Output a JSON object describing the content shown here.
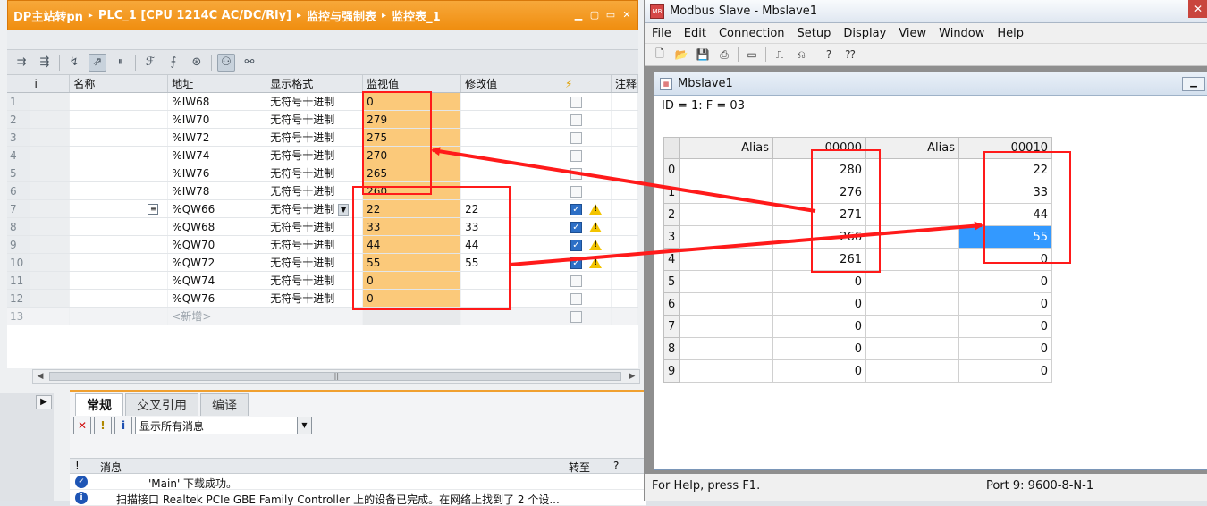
{
  "tia": {
    "breadcrumb": [
      "DP主站转pn",
      "PLC_1 [CPU 1214C AC/DC/Rly]",
      "监控与强制表",
      "监控表_1"
    ],
    "columns": {
      "info": "i",
      "name": "名称",
      "address": "地址",
      "format": "显示格式",
      "monitor": "监视值",
      "modify": "修改值",
      "comment": "注释"
    },
    "rows": [
      {
        "n": "1",
        "addr": "%IW68",
        "fmt": "无符号十进制",
        "mon": "0",
        "mod": "",
        "checked": false,
        "warn": false
      },
      {
        "n": "2",
        "addr": "%IW70",
        "fmt": "无符号十进制",
        "mon": "279",
        "mod": "",
        "checked": false,
        "warn": false
      },
      {
        "n": "3",
        "addr": "%IW72",
        "fmt": "无符号十进制",
        "mon": "275",
        "mod": "",
        "checked": false,
        "warn": false
      },
      {
        "n": "4",
        "addr": "%IW74",
        "fmt": "无符号十进制",
        "mon": "270",
        "mod": "",
        "checked": false,
        "warn": false
      },
      {
        "n": "5",
        "addr": "%IW76",
        "fmt": "无符号十进制",
        "mon": "265",
        "mod": "",
        "checked": false,
        "warn": false
      },
      {
        "n": "6",
        "addr": "%IW78",
        "fmt": "无符号十进制",
        "mon": "260",
        "mod": "",
        "checked": false,
        "warn": false
      },
      {
        "n": "7",
        "addr": "%QW66",
        "fmt": "无符号十进制",
        "mon": "22",
        "mod": "22",
        "checked": true,
        "warn": true
      },
      {
        "n": "8",
        "addr": "%QW68",
        "fmt": "无符号十进制",
        "mon": "33",
        "mod": "33",
        "checked": true,
        "warn": true
      },
      {
        "n": "9",
        "addr": "%QW70",
        "fmt": "无符号十进制",
        "mon": "44",
        "mod": "44",
        "checked": true,
        "warn": true
      },
      {
        "n": "10",
        "addr": "%QW72",
        "fmt": "无符号十进制",
        "mon": "55",
        "mod": "55",
        "checked": true,
        "warn": true
      },
      {
        "n": "11",
        "addr": "%QW74",
        "fmt": "无符号十进制",
        "mon": "0",
        "mod": "",
        "checked": false,
        "warn": false
      },
      {
        "n": "12",
        "addr": "%QW76",
        "fmt": "无符号十进制",
        "mon": "0",
        "mod": "",
        "checked": false,
        "warn": false
      }
    ],
    "new_row": {
      "n": "13",
      "addr": "<新增>"
    },
    "bottom_tabs": [
      "常规",
      "交叉引用",
      "编译"
    ],
    "filter": {
      "selected": "显示所有消息"
    },
    "msg_columns": {
      "flag": "!",
      "message": "消息",
      "goto": "转至",
      "help": "?"
    },
    "messages": [
      "'Main' 下载成功。",
      "扫描接口 Realtek PCIe GBE Family Controller 上的设备已完成。在网络上找到了 2 个设..."
    ],
    "icons": {
      "minimize": "minimize-icon",
      "restore": "restore-icon",
      "close": "close-icon"
    }
  },
  "mbs": {
    "title": "Modbus Slave - Mbslave1",
    "menu": [
      "File",
      "Edit",
      "Connection",
      "Setup",
      "Display",
      "View",
      "Window",
      "Help"
    ],
    "child_title": "Mbslave1",
    "id_line": "ID = 1: F = 03",
    "headers": {
      "alias1": "Alias",
      "col1": "00000",
      "alias2": "Alias",
      "col2": "00010"
    },
    "rows": [
      {
        "r": "0",
        "a": "280",
        "b": "22"
      },
      {
        "r": "1",
        "a": "276",
        "b": "33"
      },
      {
        "r": "2",
        "a": "271",
        "b": "44"
      },
      {
        "r": "3",
        "a": "266",
        "b": "55"
      },
      {
        "r": "4",
        "a": "261",
        "b": "0"
      },
      {
        "r": "5",
        "a": "0",
        "b": "0"
      },
      {
        "r": "6",
        "a": "0",
        "b": "0"
      },
      {
        "r": "7",
        "a": "0",
        "b": "0"
      },
      {
        "r": "8",
        "a": "0",
        "b": "0"
      },
      {
        "r": "9",
        "a": "0",
        "b": "0"
      }
    ],
    "status_left": "For Help, press F1.",
    "status_right": "Port 9: 9600-8-N-1",
    "selected_row": 3
  },
  "colors": {
    "tia_title": "#f08e10",
    "monitor_cell": "#fbc97a",
    "annotation_red": "#ff1a1a",
    "selection_blue": "#3399ff"
  }
}
